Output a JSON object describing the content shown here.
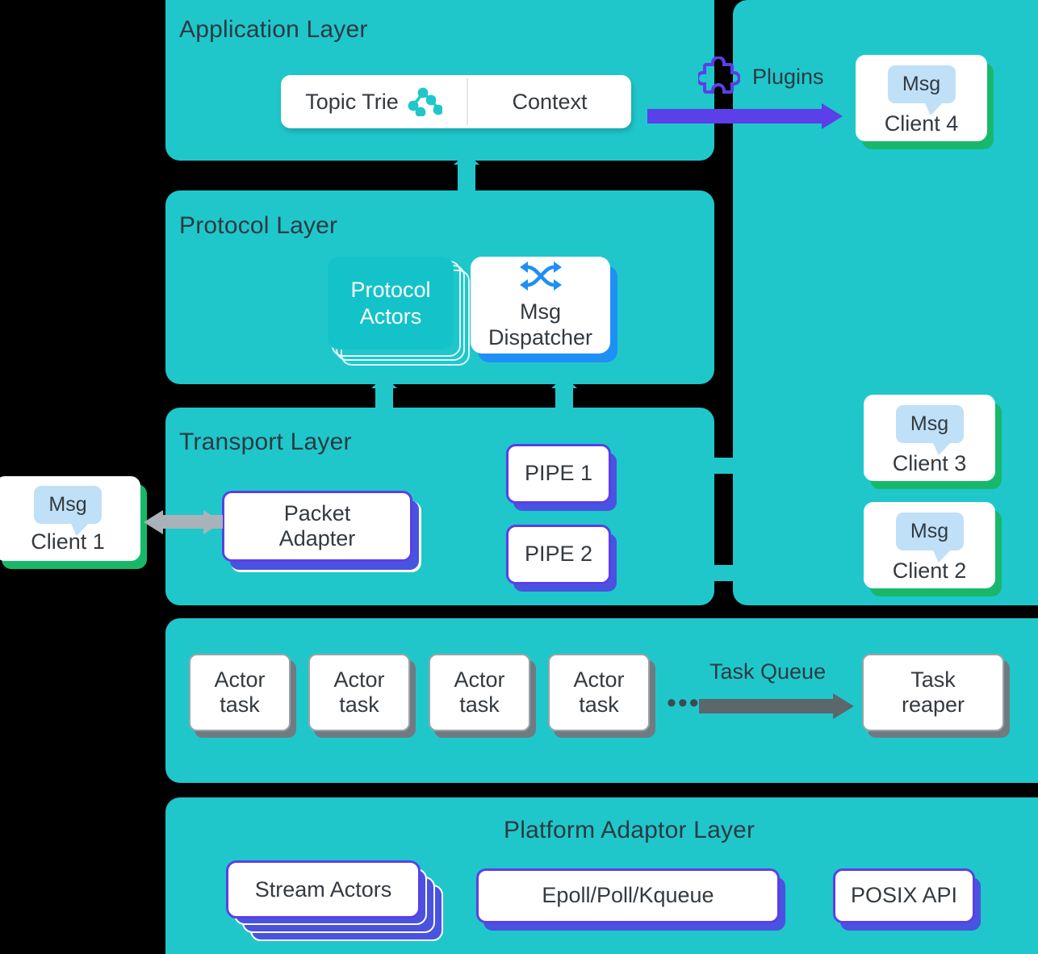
{
  "layers": {
    "application": {
      "title": "Application Layer"
    },
    "protocol": {
      "title": "Protocol Layer"
    },
    "transport": {
      "title": "Transport Layer"
    },
    "task": {
      "title": ""
    },
    "platform": {
      "title": "Platform Adaptor Layer"
    }
  },
  "application": {
    "topic_trie": "Topic Trie",
    "topic_trie_icon": "tree-graph-icon",
    "context": "Context",
    "plugins_label": "Plugins",
    "plugins_icon": "puzzle-piece-icon"
  },
  "protocol": {
    "actors": "Protocol\nActors",
    "actors_line1": "Protocol",
    "actors_line2": "Actors",
    "dispatcher_line1": "Msg",
    "dispatcher_line2": "Dispatcher",
    "dispatcher_icon": "shuffle-icon"
  },
  "transport": {
    "packet_adapter_line1": "Packet",
    "packet_adapter_line2": "Adapter",
    "pipes": [
      "PIPE 1",
      "PIPE 2"
    ]
  },
  "clients": [
    {
      "id": "client-1",
      "msg": "Msg",
      "name": "Client 1"
    },
    {
      "id": "client-2",
      "msg": "Msg",
      "name": "Client 2"
    },
    {
      "id": "client-3",
      "msg": "Msg",
      "name": "Client 3"
    },
    {
      "id": "client-4",
      "msg": "Msg",
      "name": "Client 4"
    }
  ],
  "task_layer": {
    "actor_tasks": [
      {
        "line1": "Actor",
        "line2": "task"
      },
      {
        "line1": "Actor",
        "line2": "task"
      },
      {
        "line1": "Actor",
        "line2": "task"
      },
      {
        "line1": "Actor",
        "line2": "task"
      }
    ],
    "ellipsis": "•••",
    "queue_label": "Task Queue",
    "reaper_line1": "Task",
    "reaper_line2": "reaper"
  },
  "platform": {
    "stream_actors": "Stream Actors",
    "epoll": "Epoll/Poll/Kqueue",
    "posix": "POSIX API"
  },
  "colors": {
    "layer_bg": "#1fc7cb",
    "background": "#000000",
    "accent_purple": "#5b3fe8",
    "accent_blue": "#1f8ff5",
    "client_green": "#17b86b",
    "msg_blue": "#bfe0f7",
    "task_grey": "#6f7b80",
    "text": "#333a40"
  }
}
